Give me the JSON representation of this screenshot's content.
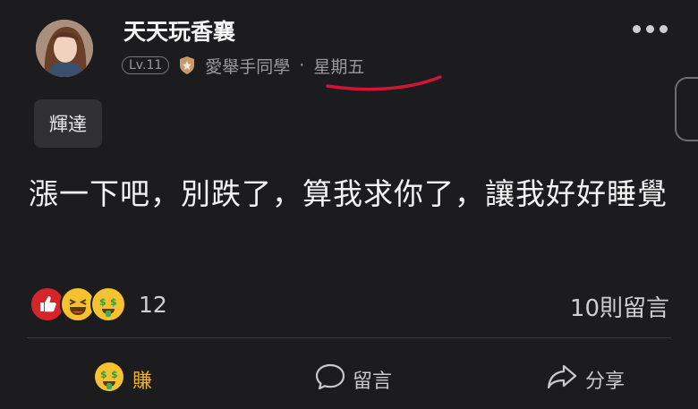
{
  "post": {
    "author_name": "天天玩香襄",
    "level": "Lv.11",
    "title": "愛舉手同學",
    "separator": "·",
    "day": "星期五",
    "topic_tag": "輝達",
    "content": "漲一下吧，別跌了，算我求你了，讓我好好睡覺"
  },
  "reactions": {
    "icons": [
      "thumbs-up-icon",
      "laughing-face-icon",
      "money-face-icon"
    ],
    "count": "12"
  },
  "comments_count": "10則留言",
  "actions": {
    "earn_label": "賺",
    "comment_label": "留言",
    "share_label": "分享"
  },
  "colors": {
    "background": "#1c1c1e",
    "earn_accent": "#f0b429",
    "annotation_underline": "#d41436",
    "like_red": "#d4262a"
  }
}
